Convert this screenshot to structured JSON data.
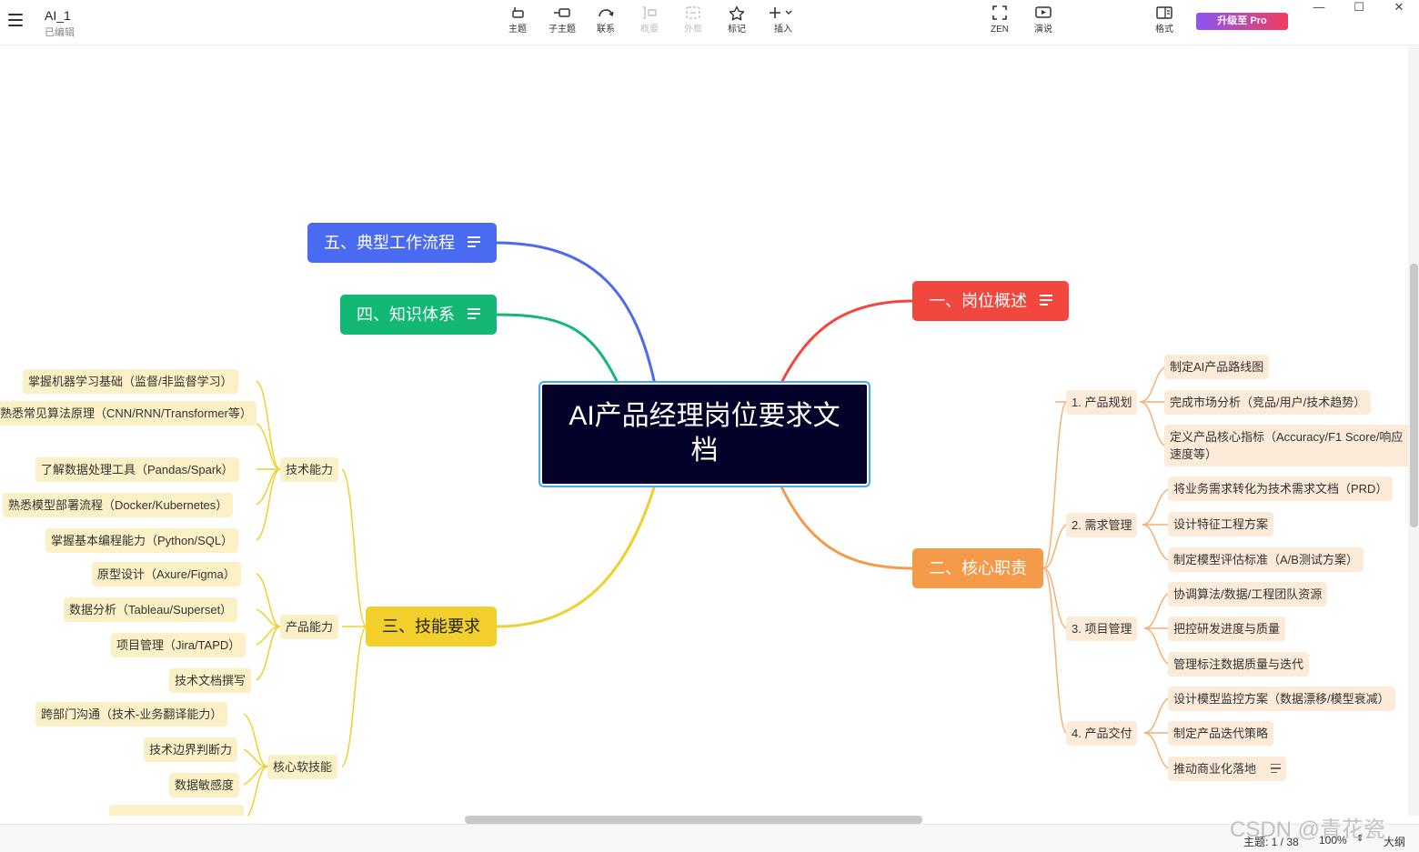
{
  "app": {
    "doc_title": "AI_1",
    "doc_status": "已编辑"
  },
  "toolbar": {
    "topic": "主题",
    "subtopic": "子主题",
    "relation": "联系",
    "summary": "概要",
    "boundary": "外框",
    "marker": "标记",
    "insert": "插入",
    "zen": "ZEN",
    "present": "演说",
    "format": "格式",
    "upgrade": "升级至 Pro"
  },
  "window": {
    "minimize": "—",
    "maximize": "☐",
    "close": "✕"
  },
  "colors": {
    "red": "#f0473e",
    "orange": "#f59a48",
    "yellow": "#f2cf2a",
    "green": "#12b874",
    "blue": "#4a6bf1",
    "root": "#02022a"
  },
  "map": {
    "root": "AI产品经理岗位要求文档",
    "b1": "一、岗位概述",
    "b2": "二、核心职责",
    "b3": "三、技能要求",
    "b4": "四、知识体系",
    "b5": "五、典型工作流程",
    "duties": [
      {
        "label": "1. 产品规划",
        "items": [
          "制定AI产品路线图",
          "完成市场分析（竞品/用户/技术趋势）",
          "定义产品核心指标（Accuracy/F1 Score/响应速度等）"
        ]
      },
      {
        "label": "2. 需求管理",
        "items": [
          "将业务需求转化为技术需求文档（PRD）",
          "设计特征工程方案",
          "制定模型评估标准（A/B测试方案）"
        ]
      },
      {
        "label": "3. 项目管理",
        "items": [
          "协调算法/数据/工程团队资源",
          "把控研发进度与质量",
          "管理标注数据质量与迭代"
        ]
      },
      {
        "label": "4. 产品交付",
        "items": [
          "设计模型监控方案（数据漂移/模型衰减）",
          "制定产品迭代策略",
          "推动商业化落地"
        ]
      }
    ],
    "skills": [
      {
        "label": "技术能力",
        "items": [
          "掌握机器学习基础（监督/非监督学习）",
          "熟悉常见算法原理（CNN/RNN/Transformer等）",
          "了解数据处理工具（Pandas/Spark）",
          "熟悉模型部署流程（Docker/Kubernetes）",
          "掌握基本编程能力（Python/SQL）"
        ]
      },
      {
        "label": "产品能力",
        "items": [
          "原型设计（Axure/Figma）",
          "数据分析（Tableau/Superset）",
          "项目管理（Jira/TAPD）",
          "技术文档撰写"
        ]
      },
      {
        "label": "核心软技能",
        "items": [
          "跨部门沟通（技术-业务翻译能力）",
          "技术边界判断力",
          "数据敏感度"
        ]
      }
    ]
  },
  "status": {
    "topic_count": "主题: 1 / 38",
    "zoom": "100%",
    "outline": "大纲"
  },
  "watermark": "CSDN @青花瓷"
}
